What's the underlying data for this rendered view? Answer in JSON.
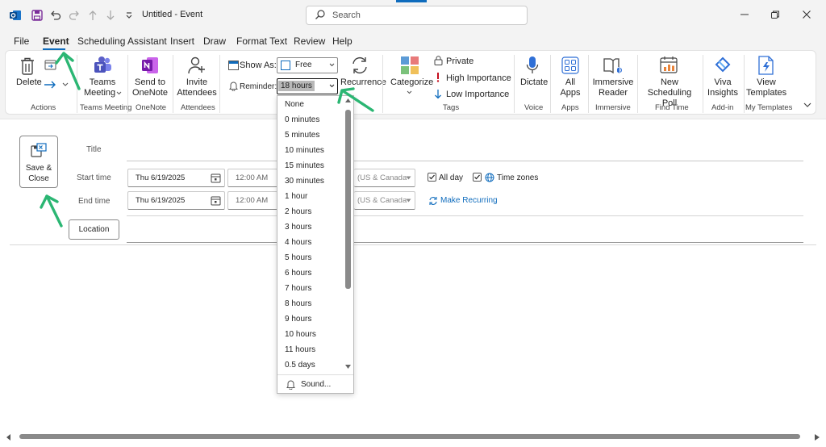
{
  "titlebar": {
    "title": "Untitled  -  Event",
    "search_placeholder": "Search"
  },
  "menu": {
    "items": [
      "File",
      "Event",
      "Scheduling Assistant",
      "Insert",
      "Draw",
      "Format Text",
      "Review",
      "Help"
    ],
    "active": "Event"
  },
  "ribbon": {
    "actions": {
      "delete_label": "Delete",
      "group_label": "Actions"
    },
    "teams": {
      "button_line1": "Teams",
      "button_line2": "Meeting",
      "group_label": "Teams Meeting"
    },
    "onenote": {
      "button_line1": "Send to",
      "button_line2": "OneNote",
      "group_label": "OneNote"
    },
    "attendees": {
      "button_line1": "Invite",
      "button_line2": "Attendees",
      "group_label": "Attendees"
    },
    "options": {
      "show_as_label": "Show As:",
      "show_as_value": "Free",
      "reminder_label": "Reminder:",
      "reminder_value": "18 hours",
      "recurrence_label": "Recurrence"
    },
    "tags": {
      "categorize_label": "Categorize",
      "private_label": "Private",
      "high_label": "High Importance",
      "low_label": "Low Importance",
      "group_label": "Tags"
    },
    "voice": {
      "button_label": "Dictate",
      "group_label": "Voice"
    },
    "apps": {
      "button_line1": "All",
      "button_line2": "Apps",
      "group_label": "Apps"
    },
    "immersive": {
      "button_line1": "Immersive",
      "button_line2": "Reader",
      "group_label": "Immersive"
    },
    "findtime": {
      "button_line1": "New",
      "button_line2": "Scheduling Poll",
      "group_label": "Find Time"
    },
    "viva": {
      "button_line1": "Viva",
      "button_line2": "Insights",
      "group_label": "Add-in"
    },
    "templates": {
      "button_line1": "View",
      "button_line2": "Templates",
      "group_label": "My Templates"
    }
  },
  "form": {
    "save_line1": "Save &",
    "save_line2": "Close",
    "title_label": "Title",
    "start_label": "Start time",
    "end_label": "End time",
    "start_date": "Thu 6/19/2025",
    "end_date": "Thu 6/19/2025",
    "start_time": "12:00 AM",
    "end_time": "12:00 AM",
    "tz_start": "(US & Canada",
    "tz_end": "(US & Canada",
    "all_day_label": "All day",
    "time_zones_label": "Time zones",
    "make_recurring_label": "Make Recurring",
    "location_label": "Location"
  },
  "reminder_options": [
    "None",
    "0 minutes",
    "5 minutes",
    "10 minutes",
    "15 minutes",
    "30 minutes",
    "1 hour",
    "2 hours",
    "3 hours",
    "4 hours",
    "5 hours",
    "6 hours",
    "7 hours",
    "8 hours",
    "9 hours",
    "10 hours",
    "11 hours",
    "0.5 days"
  ],
  "reminder_sound_label": "Sound...",
  "colors": {
    "accent": "#0f6cbd",
    "annotation_arrow": "#2bb673",
    "teams": "#5b5fc7",
    "onenote": "#7719aa",
    "high_importance": "#c50f1f",
    "low_importance": "#0f6cbd"
  }
}
